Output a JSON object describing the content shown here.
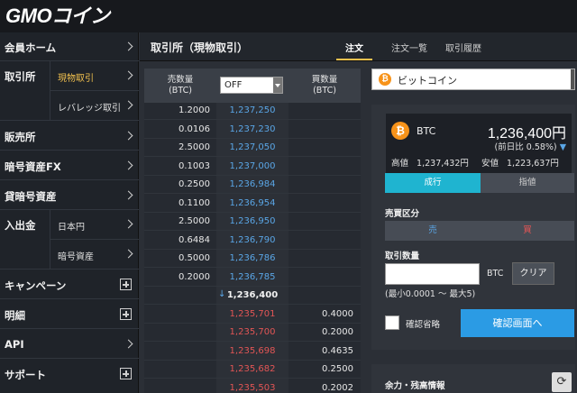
{
  "brand": {
    "logo": "GMOコイン"
  },
  "sidebar": {
    "items": [
      {
        "label": "会員ホーム"
      },
      {
        "label": "取引所",
        "subs": [
          "現物取引",
          "レバレッジ取引"
        ]
      },
      {
        "label": "販売所"
      },
      {
        "label": "暗号資産FX"
      },
      {
        "label": "貸暗号資産"
      },
      {
        "label": "入出金",
        "subs": [
          "日本円",
          "暗号資産"
        ]
      },
      {
        "label": "キャンペーン"
      },
      {
        "label": "明細"
      },
      {
        "label": "API"
      },
      {
        "label": "サポート"
      }
    ]
  },
  "header": {
    "title": "取引所（現物取引）",
    "tabs": [
      "注文",
      "注文一覧",
      "取引履歴"
    ]
  },
  "orderbook": {
    "sell_header": "売数量\n(BTC)",
    "buy_header": "買数量\n(BTC)",
    "grouping_value": "OFF",
    "asks": [
      {
        "qty": "1.2000",
        "price": "1,237,250"
      },
      {
        "qty": "0.0106",
        "price": "1,237,230"
      },
      {
        "qty": "2.5000",
        "price": "1,237,050"
      },
      {
        "qty": "0.1003",
        "price": "1,237,000"
      },
      {
        "qty": "0.2500",
        "price": "1,236,984"
      },
      {
        "qty": "0.1100",
        "price": "1,236,954"
      },
      {
        "qty": "2.5000",
        "price": "1,236,950"
      },
      {
        "qty": "0.6484",
        "price": "1,236,790"
      },
      {
        "qty": "0.5000",
        "price": "1,236,786"
      },
      {
        "qty": "0.2000",
        "price": "1,236,785"
      }
    ],
    "mid": "1,236,400",
    "bids": [
      {
        "price": "1,235,701",
        "qty": "0.4000"
      },
      {
        "price": "1,235,700",
        "qty": "0.2000"
      },
      {
        "price": "1,235,698",
        "qty": "0.4635"
      },
      {
        "price": "1,235,682",
        "qty": "0.2500"
      },
      {
        "price": "1,235,503",
        "qty": "0.2002"
      }
    ]
  },
  "panel": {
    "coin_name": "ビットコイン",
    "ticker": {
      "symbol": "BTC",
      "price": "1,236,400円",
      "change": "(前日比 0.58%)",
      "high_label": "高値",
      "high": "1,237,432円",
      "low_label": "安値",
      "low": "1,223,637円"
    },
    "order_types": [
      "成行",
      "指値"
    ],
    "side_label": "売買区分",
    "sides": [
      "売",
      "買"
    ],
    "qty_label": "取引数量",
    "qty_unit": "BTC",
    "clear_label": "クリア",
    "qty_range": "(最小0.0001 ～ 最大5)",
    "confirm_skip_label": "確認省略",
    "confirm_button": "確認画面へ",
    "balance_title": "余力・残高情報"
  },
  "colors": {
    "ask_price": "#5aa6e6",
    "bid_price": "#e25555",
    "accent": "#f2c14e",
    "market_active": "#1fb4d0",
    "confirm_btn": "#2b9be4"
  }
}
